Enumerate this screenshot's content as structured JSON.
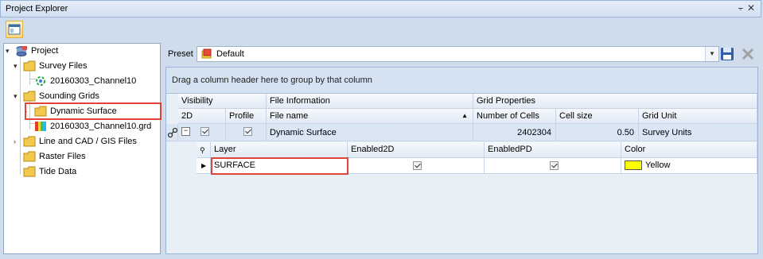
{
  "titlebar": {
    "title": "Project Explorer",
    "pin": "⨪",
    "close": "✕"
  },
  "tree": {
    "items": [
      {
        "label": "Project",
        "icon": "project-icon"
      },
      {
        "label": "Survey Files",
        "icon": "folder-icon"
      },
      {
        "label": "20160303_Channel10",
        "icon": "survey-file-icon"
      },
      {
        "label": "Sounding Grids",
        "icon": "folder-icon"
      },
      {
        "label": "Dynamic Surface",
        "icon": "folder-icon"
      },
      {
        "label": "20160303_Channel10.grd",
        "icon": "grid-file-icon"
      },
      {
        "label": "Line and CAD / GIS Files",
        "icon": "folder-icon"
      },
      {
        "label": "Raster Files",
        "icon": "folder-icon"
      },
      {
        "label": "Tide Data",
        "icon": "folder-icon"
      }
    ]
  },
  "preset": {
    "label": "Preset",
    "value": "Default"
  },
  "grid": {
    "group_hint": "Drag a column header here to group by that column",
    "bands": [
      "Visibility",
      "File Information",
      "Grid Properties"
    ],
    "columns": [
      "2D",
      "Profile",
      "File name",
      "Number of Cells",
      "Cell size",
      "Grid Unit"
    ],
    "row": {
      "file_name": "Dynamic Surface",
      "cells": "2402304",
      "cell_size": "0.50",
      "unit": "Survey Units"
    },
    "detail": {
      "columns": [
        "Layer",
        "Enabled2D",
        "EnabledPD",
        "Color"
      ],
      "row": {
        "layer": "SURFACE",
        "color": "Yellow"
      }
    }
  },
  "colors": {
    "highlight": "#e0453a",
    "swatch": "#ffff00",
    "folder": "#f2c94c"
  }
}
